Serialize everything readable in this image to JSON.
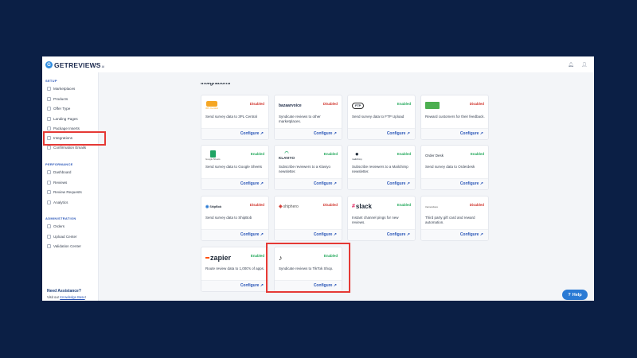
{
  "app": {
    "logo_text": "GETREVIEWS",
    "logo_sup": "AI",
    "logo_mark": "G",
    "bell_icon": "bell-icon",
    "user_icon": "user-icon"
  },
  "sidebar": {
    "setup_label": "SETUP",
    "setup_items": [
      "Marketplaces",
      "Products",
      "Offer Type",
      "Landing Pages",
      "Package Inserts",
      "Integrations",
      "Confirmation Emails"
    ],
    "performance_label": "PERFORMANCE",
    "performance_items": [
      "Dashboard",
      "Reviews",
      "Review Requests",
      "Analytics"
    ],
    "administration_label": "ADMINISTRATION",
    "administration_items": [
      "Orders",
      "Upload Center",
      "Validation Center"
    ],
    "assist_title": "Need Assistance?",
    "assist_text": "Visit our ",
    "assist_link": "Knowledge Base",
    "assist_end": "!"
  },
  "main": {
    "heading": "Integrations",
    "configure_label": "Configure ↗"
  },
  "cards": [
    {
      "logo": "3PL Central",
      "status": "Disabled",
      "desc": "Send survey data to 3PL Central"
    },
    {
      "logo": "bazaarvoice",
      "status": "Disabled",
      "desc": "Syndicate reviews to other marketplaces."
    },
    {
      "logo": "FTP",
      "status": "Enabled",
      "desc": "Send survey data to FTP Upload"
    },
    {
      "logo": "",
      "status": "Disabled",
      "desc": "Reward customers for their feedback."
    },
    {
      "logo": "Google Sheets",
      "status": "Enabled",
      "desc": "Send survey data to Google Sheets"
    },
    {
      "logo": "KLAVIYO",
      "status": "Enabled",
      "desc": "Subscribe reviewers to a Klaviyo newsletter."
    },
    {
      "logo": "mailchimp",
      "status": "Enabled",
      "desc": "Subscribe reviewers to a Mailchimp newsletter."
    },
    {
      "logo": "Order Desk",
      "status": "Enabled",
      "desc": "Send survey data to Orderdesk"
    },
    {
      "logo": "ShipBob",
      "status": "Disabled",
      "desc": "Send survey data to ShipBob"
    },
    {
      "logo": "shiphero",
      "status": "Disabled",
      "desc": ""
    },
    {
      "logo": "slack",
      "status": "Enabled",
      "desc": "Instant channel pings for new reviews."
    },
    {
      "logo": "tremendous",
      "status": "Disabled",
      "desc": "Third party gift card and reward automation."
    },
    {
      "logo": "zapier",
      "status": "Enabled",
      "desc": "Route review data to 1,000's of apps."
    },
    {
      "logo": "TikTok",
      "status": "Enabled",
      "desc": "Syndicate reviews to TikTok Shop."
    }
  ],
  "colors": {
    "enabled": "#22a85a",
    "disabled": "#d0342c",
    "accent": "#2a56b8",
    "highlight": "#e53935",
    "page_bg": "#0b1f45"
  },
  "help": {
    "label": "Help",
    "icon": "help-circle-icon"
  }
}
